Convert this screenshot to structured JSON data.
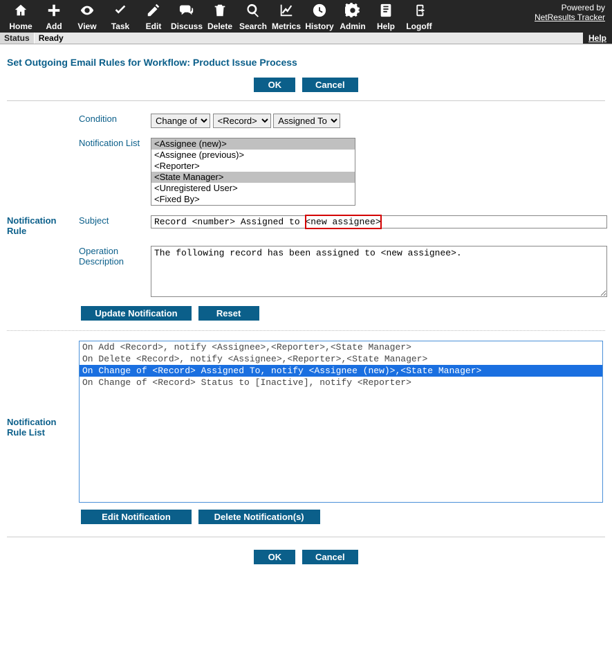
{
  "powered": {
    "label": "Powered by",
    "link": "NetResults Tracker"
  },
  "toolbar": [
    {
      "name": "home",
      "label": "Home"
    },
    {
      "name": "add",
      "label": "Add"
    },
    {
      "name": "view",
      "label": "View"
    },
    {
      "name": "task",
      "label": "Task"
    },
    {
      "name": "edit",
      "label": "Edit"
    },
    {
      "name": "discuss",
      "label": "Discuss"
    },
    {
      "name": "delete",
      "label": "Delete"
    },
    {
      "name": "search",
      "label": "Search"
    },
    {
      "name": "metrics",
      "label": "Metrics"
    },
    {
      "name": "history",
      "label": "History"
    },
    {
      "name": "admin",
      "label": "Admin"
    },
    {
      "name": "help",
      "label": "Help"
    },
    {
      "name": "logoff",
      "label": "Logoff"
    }
  ],
  "statusbar": {
    "status": "Status",
    "ready": "Ready",
    "help": "Help"
  },
  "page_title": "Set Outgoing Email Rules for Workflow: Product Issue Process",
  "buttons": {
    "ok": "OK",
    "cancel": "Cancel",
    "update": "Update Notification",
    "reset": "Reset",
    "edit": "Edit Notification",
    "delete": "Delete Notification(s)"
  },
  "labels": {
    "notification_rule": "Notification Rule",
    "condition": "Condition",
    "notification_list": "Notification List",
    "subject": "Subject",
    "operation_description": "Operation Description",
    "notification_rule_list": "Notification Rule List"
  },
  "condition": {
    "sel1": "Change of",
    "sel2": "<Record>",
    "sel3": "Assigned To"
  },
  "notification_list": {
    "options": [
      {
        "text": "<Assignee (new)>",
        "selected": true
      },
      {
        "text": "<Assignee (previous)>",
        "selected": false
      },
      {
        "text": "<Reporter>",
        "selected": false
      },
      {
        "text": "<State Manager>",
        "selected": true
      },
      {
        "text": "<Unregistered User>",
        "selected": false
      },
      {
        "text": "<Fixed By>",
        "selected": false
      }
    ]
  },
  "subject_value": "Record <number> Assigned to <new assignee>",
  "subject_highlight": "<new assignee>",
  "opdesc_value": "The following record has been assigned to <new assignee>.",
  "rule_list": [
    {
      "text": "On Add <Record>, notify <Assignee>,<Reporter>,<State Manager>",
      "selected": false
    },
    {
      "text": "On Delete <Record>, notify <Assignee>,<Reporter>,<State Manager>",
      "selected": false
    },
    {
      "text": "On Change of <Record> Assigned To, notify <Assignee (new)>,<State Manager>",
      "selected": true
    },
    {
      "text": "On Change of <Record> Status to [Inactive], notify <Reporter>",
      "selected": false
    }
  ]
}
